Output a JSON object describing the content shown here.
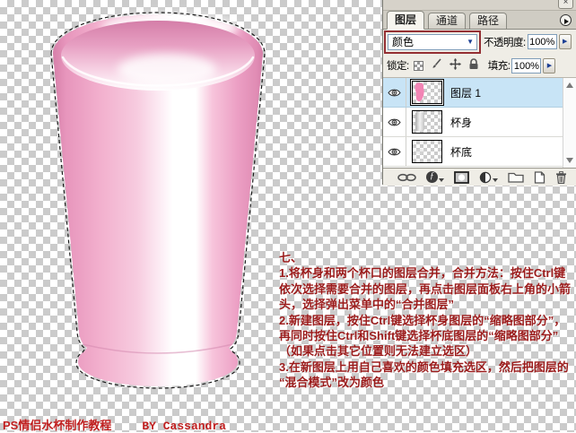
{
  "canvas": {
    "checker_light": "#FFFFFF",
    "checker_dark": "#CBCBCB"
  },
  "cup": {
    "edge_pink": "#D67FA9",
    "main_pink": "#F2AFCD",
    "highlight": "#FFFFFF",
    "selection": "marching-ants"
  },
  "layers_panel": {
    "tabs": [
      {
        "label": "图层",
        "active": true
      },
      {
        "label": "通道",
        "active": false
      },
      {
        "label": "路径",
        "active": false
      }
    ],
    "blend_mode": {
      "value": "颜色",
      "annotation_color": "#942F33"
    },
    "opacity": {
      "label": "不透明度:",
      "value": "100%"
    },
    "lock": {
      "label": "锁定:"
    },
    "fill": {
      "label": "填充:",
      "value": "100%"
    },
    "layers": [
      {
        "name": "图层 1",
        "selected": true,
        "visible": true
      },
      {
        "name": "杯身",
        "selected": false,
        "visible": true
      },
      {
        "name": "杯底",
        "selected": false,
        "visible": true
      }
    ],
    "selected_row_color": "#C8E4F6"
  },
  "instructions": {
    "color": "#9B1B1B",
    "lines": [
      "七、",
      "1.将杯身和两个杯口的图层合并，合并方法：按住Ctrl键",
      "依次选择需要合并的图层，再点击图层面板右上角的小箭",
      "头，选择弹出菜单中的“合并图层”",
      "2.新建图层，按住Ctrl键选择杯身图层的“缩略图部分”，",
      "再同时按住Ctrl和Shift键选择杯底图层的“缩略图部分”",
      "（如果点击其它位置则无法建立选区）",
      "3.在新图层上用自己喜欢的颜色填充选区，然后把图层的",
      "“混合模式”改为颜色"
    ]
  },
  "watermark": {
    "title": "PS情侣水杯制作教程",
    "author": "BY Cassandra",
    "color": "#C01F1F"
  }
}
